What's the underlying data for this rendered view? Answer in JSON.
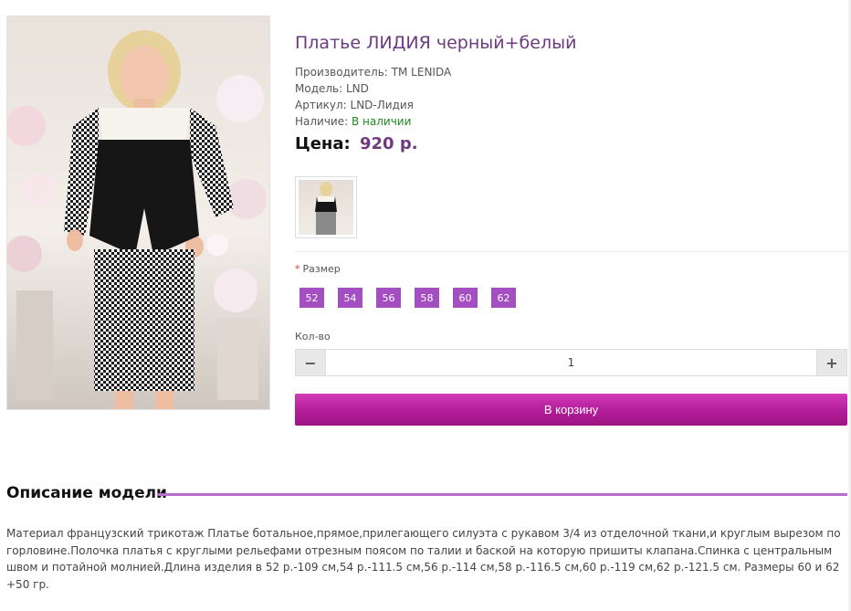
{
  "product": {
    "title": "Платье ЛИДИЯ черный+белый",
    "manufacturer_label": "Производитель:",
    "manufacturer": "TM LENIDA",
    "model_label": "Модель:",
    "model": "LND",
    "sku_label": "Артикул:",
    "sku": "LND-Лидия",
    "availability_label": "Наличие:",
    "availability": "В наличии",
    "price_label": "Цена:",
    "price": "920 р."
  },
  "options": {
    "size_label": "Размер",
    "required_mark": "*",
    "sizes": [
      "52",
      "54",
      "56",
      "58",
      "60",
      "62"
    ]
  },
  "quantity": {
    "label": "Кол-во",
    "value": "1",
    "minus": "−",
    "plus": "+"
  },
  "cart": {
    "button_label": "В корзину"
  },
  "description": {
    "heading": "Описание модели",
    "text": "Материал французский трикотаж Платье ботальное,прямое,прилегающего силуэта с рукавом 3/4 из отделочной ткани,и круглым вырезом по горловине.Полочка платья с круглыми рельефами отрезным поясом по талии и баской на которую пришиты клапана.Спинка с центральным швом и потайной молнией.Длина изделия в 52 р.-109 см,54 р.-111.5 см,56 р.-114 см,58 р.-116.5 см,60 р.-119 см,62 р.-121.5 см. Размеры 60 и 62 +50 гр."
  },
  "colors": {
    "title": "#6d3a80",
    "accent": "#a34fc2",
    "cart_button": "#b21d98",
    "in_stock": "#1f8a1f",
    "section_rule": "#b56fc9"
  }
}
